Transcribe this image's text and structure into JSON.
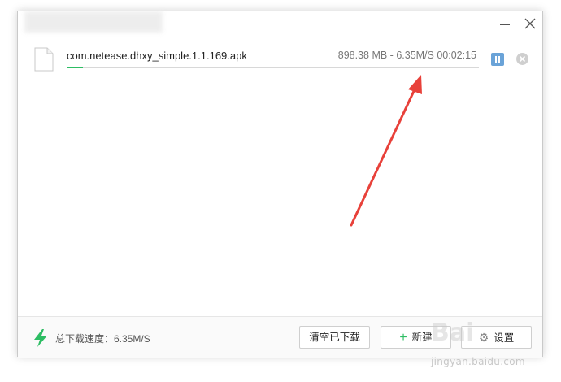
{
  "window": {
    "minimize_icon": "minimize-icon",
    "close_icon": "close-icon"
  },
  "download": {
    "file_name": "com.netease.dhxy_simple.1.1.169.apk",
    "file_info": "898.38 MB - 6.35M/S 00:02:15",
    "progress_percent": 4,
    "pause_icon": "pause-icon",
    "cancel_icon": "close-circle-icon"
  },
  "footer": {
    "speed_label": "总下载速度：6.35M/S",
    "clear_label": "清空已下载",
    "new_label": "新建",
    "settings_label": "设置"
  },
  "annotation": {
    "arrow_color": "#e8413a"
  },
  "watermark": {
    "logo": "Bai",
    "text": "jingyan.baidu.com"
  },
  "colors": {
    "progress": "#2dbd63",
    "pause_button": "#6aa3d8",
    "accent_plus": "#2dbd63"
  }
}
